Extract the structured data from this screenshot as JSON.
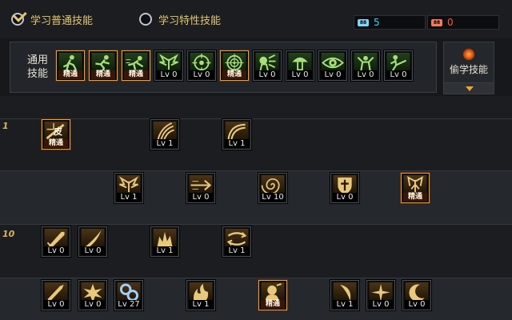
{
  "tabs": {
    "common": "学习普通技能",
    "special": "学习特性技能"
  },
  "counters": {
    "left_value": "5",
    "right_value": "0",
    "left_color": "#3fd0ff",
    "right_color": "#ff5a3a"
  },
  "panel": {
    "label_line1": "通用",
    "label_line2": "技能",
    "steal_label": "偷学技能"
  },
  "level_markers": [
    "1",
    "10"
  ],
  "mastered_label": "精通",
  "common_skills": [
    {
      "icon": "running-figure-icon",
      "level": "精通",
      "mastered": true
    },
    {
      "icon": "sprinting-figure-icon",
      "level": "精通",
      "mastered": true
    },
    {
      "icon": "dash-figure-icon",
      "level": "精通",
      "mastered": true
    },
    {
      "icon": "wings-icon",
      "level": "Lv 0",
      "mastered": false
    },
    {
      "icon": "crosshair-icon",
      "level": "Lv 0",
      "mastered": false
    },
    {
      "icon": "target-icon",
      "level": "精通",
      "mastered": true
    },
    {
      "icon": "shout-figure-icon",
      "level": "Lv 0",
      "mastered": false
    },
    {
      "icon": "mushroom-figure-icon",
      "level": "Lv 0",
      "mastered": false
    },
    {
      "icon": "eye-icon",
      "level": "Lv 0",
      "mastered": false
    },
    {
      "icon": "summon-figure-icon",
      "level": "Lv 0",
      "mastered": false
    },
    {
      "icon": "kick-figure-icon",
      "level": "Lv 0",
      "mastered": false
    }
  ],
  "tree": [
    {
      "row": 1,
      "icon": "skin-badge-icon",
      "level": "精通",
      "mastered": true,
      "label": "皮"
    },
    {
      "row": 1,
      "icon": "claw-slash-icon",
      "level": "Lv 1",
      "mastered": false
    },
    {
      "row": 1,
      "icon": "arc-slash-icon",
      "level": "Lv 1",
      "mastered": false
    },
    {
      "row": 2,
      "icon": "wings-icon",
      "level": "Lv 1",
      "mastered": false
    },
    {
      "row": 2,
      "icon": "arrow-thrust-icon",
      "level": "Lv 0",
      "mastered": false
    },
    {
      "row": 2,
      "icon": "spiral-icon",
      "level": "Lv 10",
      "mastered": false
    },
    {
      "row": 2,
      "icon": "shield-cross-icon",
      "level": "Lv 0",
      "mastered": false
    },
    {
      "row": 2,
      "icon": "fan-wings-icon",
      "level": "精通",
      "mastered": true
    },
    {
      "row": 3,
      "icon": "sword-icon",
      "level": "Lv 0",
      "mastered": false
    },
    {
      "row": 3,
      "icon": "blade-icon",
      "level": "Lv 0",
      "mastered": false
    },
    {
      "row": 3,
      "icon": "flame-burst-icon",
      "level": "Lv 1",
      "mastered": false
    },
    {
      "row": 3,
      "icon": "vortex-icon",
      "level": "Lv 1",
      "mastered": false
    },
    {
      "row": 4,
      "icon": "greatsword-icon",
      "level": "Lv 0",
      "mastered": false
    },
    {
      "row": 4,
      "icon": "burst-star-icon",
      "level": "Lv 0",
      "mastered": false
    },
    {
      "row": 4,
      "icon": "gears-icon",
      "level": "Lv 27",
      "mastered": false
    },
    {
      "row": 4,
      "icon": "fire-wave-icon",
      "level": "Lv 1",
      "mastered": false
    },
    {
      "row": 4,
      "icon": "warrior-head-icon",
      "level": "精通",
      "mastered": true
    },
    {
      "row": 4,
      "icon": "crescent-slash-icon",
      "level": "Lv 1",
      "mastered": false
    },
    {
      "row": 4,
      "icon": "cross-star-icon",
      "level": "Lv 0",
      "mastered": false
    },
    {
      "row": 4,
      "icon": "moon-arc-icon",
      "level": "Lv 0",
      "mastered": false
    }
  ]
}
